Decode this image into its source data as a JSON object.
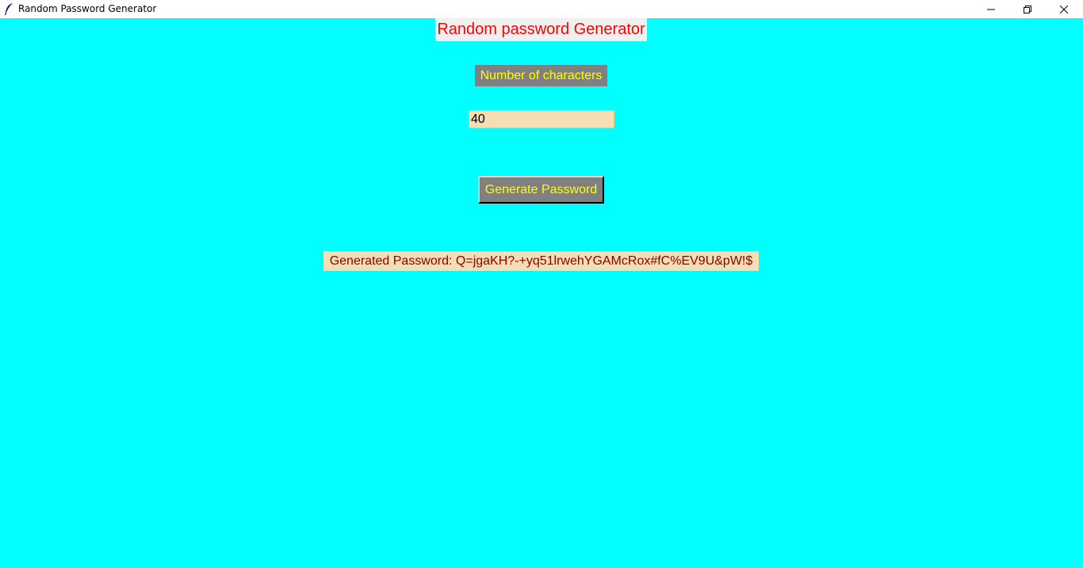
{
  "window": {
    "title": "Random Password Generator",
    "app_icon": "feather-icon",
    "controls": {
      "minimize_icon": "minimize-icon",
      "restore_icon": "restore-icon",
      "close_icon": "close-icon"
    }
  },
  "main": {
    "heading": "Random password Generator",
    "length_label": "Number of characters",
    "length_value": "40",
    "generate_button": "Generate Password",
    "result_text": "Generated Password: Q=jgaKH?-+yq51lrwehYGAMcRox#fC%EV9U&pW!$"
  },
  "colors": {
    "background": "#00ffff",
    "heading_text": "#ff0000",
    "label_bg": "#808080",
    "label_text": "#ffff00",
    "input_bg": "#f5deb3",
    "result_text": "#8b0000"
  }
}
